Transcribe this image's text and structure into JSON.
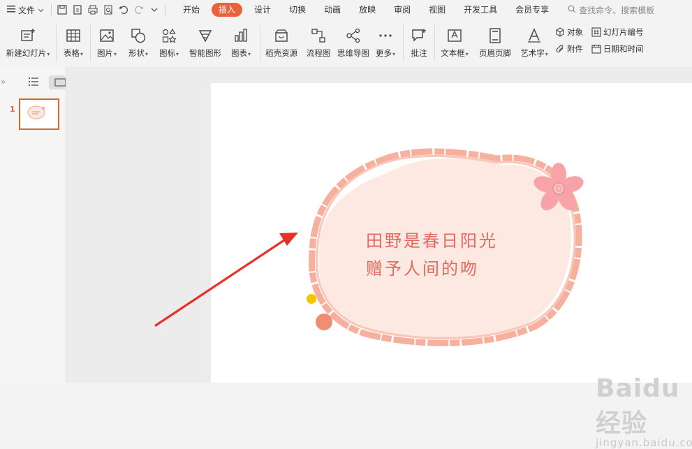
{
  "menubar": {
    "file_label": "文件",
    "tabs": [
      "开始",
      "插入",
      "设计",
      "切换",
      "动画",
      "放映",
      "审阅",
      "视图",
      "开发工具",
      "会员专享"
    ],
    "active_tab": "插入",
    "search_placeholder": "查找命令、搜索模板"
  },
  "ribbon": {
    "new_slide": "新建幻灯片",
    "table": "表格",
    "picture": "图片",
    "shape": "形状",
    "icon": "图标",
    "smartart": "智能图形",
    "chart": "图表",
    "resources": "稻壳资源",
    "flowchart": "流程图",
    "mindmap": "思维导图",
    "more": "更多",
    "comment": "批注",
    "textbox": "文本框",
    "header_footer": "页眉页脚",
    "wordart": "艺术字",
    "object": "对象",
    "attachment": "附件",
    "slide_number": "幻灯片编号",
    "date_time": "日期和时间"
  },
  "panel": {
    "slide_number": "1"
  },
  "slide": {
    "line1": "田野是春日阳光",
    "line2": "赠予人间的吻"
  },
  "watermark": {
    "logo": "Baidu经验",
    "url": "jingyan.baidu.com"
  },
  "colors": {
    "accent": "#e8623b",
    "text": "#e36a5e",
    "frame": "#f7b09e",
    "blob": "#fde9e2",
    "arrow": "#e8302b"
  }
}
